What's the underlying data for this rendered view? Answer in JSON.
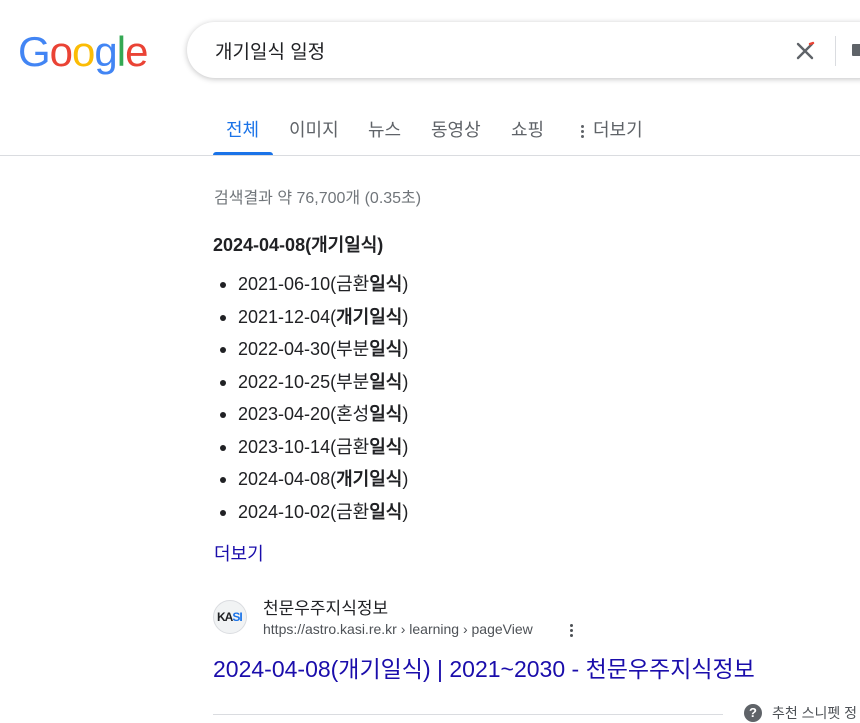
{
  "logo": {
    "text": "Google"
  },
  "search": {
    "query": "개기일식 일정"
  },
  "tabs": [
    {
      "label": "전체"
    },
    {
      "label": "이미지"
    },
    {
      "label": "뉴스"
    },
    {
      "label": "동영상"
    },
    {
      "label": "쇼핑"
    },
    {
      "label": "더보기"
    }
  ],
  "stats": "검색결과 약 76,700개 (0.35초)",
  "answer": {
    "title": "2024-04-08(개기일식)",
    "items": [
      {
        "date": "2021-06-10(",
        "plain": "금환",
        "bold": "일식",
        "end": ")"
      },
      {
        "date": "2021-12-04(",
        "plain": "",
        "bold": "개기일식",
        "end": ")"
      },
      {
        "date": "2022-04-30(",
        "plain": "부분",
        "bold": "일식",
        "end": ")"
      },
      {
        "date": "2022-10-25(",
        "plain": "부분",
        "bold": "일식",
        "end": ")"
      },
      {
        "date": "2023-04-20(",
        "plain": "혼성",
        "bold": "일식",
        "end": ")"
      },
      {
        "date": "2023-10-14(",
        "plain": "금환",
        "bold": "일식",
        "end": ")"
      },
      {
        "date": "2024-04-08(",
        "plain": "",
        "bold": "개기일식",
        "end": ")"
      },
      {
        "date": "2024-10-02(",
        "plain": "금환",
        "bold": "일식",
        "end": ")"
      }
    ],
    "more_label": "더보기"
  },
  "result": {
    "favicon_text": "KASI",
    "site_name": "천문우주지식정보",
    "url": "https://astro.kasi.re.kr › learning › pageView",
    "title": "2024-04-08(개기일식) | 2021~2030 - 천문우주지식정보"
  },
  "footer": {
    "featured_label": "추천 스니펫 정"
  },
  "colors": {
    "link": "#1a0dab",
    "accent": "#1a73e8",
    "muted": "#70757a"
  }
}
